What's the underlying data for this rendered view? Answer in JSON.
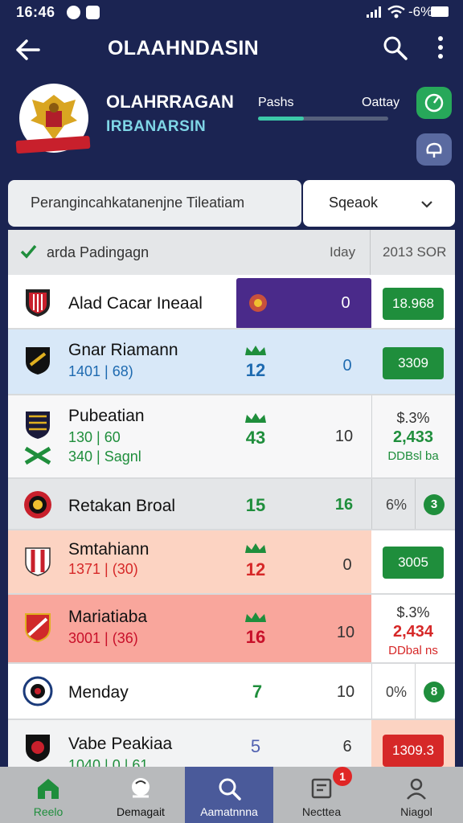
{
  "status_bar": {
    "time": "16:46",
    "battery_label": "-6%"
  },
  "app_bar": {
    "title": "OLAAHNDASIN"
  },
  "club": {
    "name": "OLAHRRAGAN",
    "subtitle": "IRBANARSIN",
    "stat_left_label": "Pashs",
    "stat_right_label": "Oattay",
    "progress_fraction": 0.35
  },
  "filter": {
    "label": "Perangincahkatanenjne Tileatiam",
    "select_value": "Sqeaok"
  },
  "table": {
    "header": {
      "team": "arda Padingagn",
      "day": "Iday",
      "score": "2013 SOR"
    },
    "rows": [
      {
        "name": "Alad Cacar Ineaal",
        "stat": "",
        "val": "0",
        "score": "18.968",
        "score_color": "#1f8e3c"
      },
      {
        "name": "Gnar Riamann",
        "sub": "1401 | 68)",
        "stat": "12",
        "val": "0",
        "score": "3309",
        "score_color": "#1f8e3c"
      },
      {
        "name": "Pubeatian",
        "sub1": "130 | 60",
        "sub2": "340 | Sagnl",
        "stat": "43",
        "val": "10",
        "score_line1": "$.3%",
        "score_line2": "2,433",
        "score_line3": "DDBsl ba"
      },
      {
        "name": "Retakan Broal",
        "stat": "15",
        "val": "16",
        "pct": "6%",
        "pill": "3"
      },
      {
        "name": "Smtahiann",
        "sub": "1371 | (30)",
        "stat": "12",
        "val": "0",
        "score": "3005",
        "score_color": "#1f8e3c"
      },
      {
        "name": "Mariatiaba",
        "sub": "3001 | (36)",
        "stat": "16",
        "val": "10",
        "score_line1": "$.3%",
        "score_line2": "2,434",
        "score_line3": "DDbal ns"
      },
      {
        "name": "Menday",
        "stat": "7",
        "val": "10",
        "pct": "0%",
        "pill": "8"
      },
      {
        "name": "Vabe Peakiaa",
        "sub": "1040 | 0 | 61",
        "stat": "5",
        "val": "6",
        "score": "1309.3",
        "score_color": "#d62828"
      }
    ]
  },
  "bottom_nav": [
    {
      "label": "Reelo",
      "icon": "home-icon"
    },
    {
      "label": "Demagait",
      "icon": "ball-icon"
    },
    {
      "label": "Aamatnnna",
      "icon": "search-icon"
    },
    {
      "label": "Necttea",
      "icon": "notes-icon",
      "badge": "1"
    },
    {
      "label": "Niagol",
      "icon": "profile-icon"
    }
  ]
}
